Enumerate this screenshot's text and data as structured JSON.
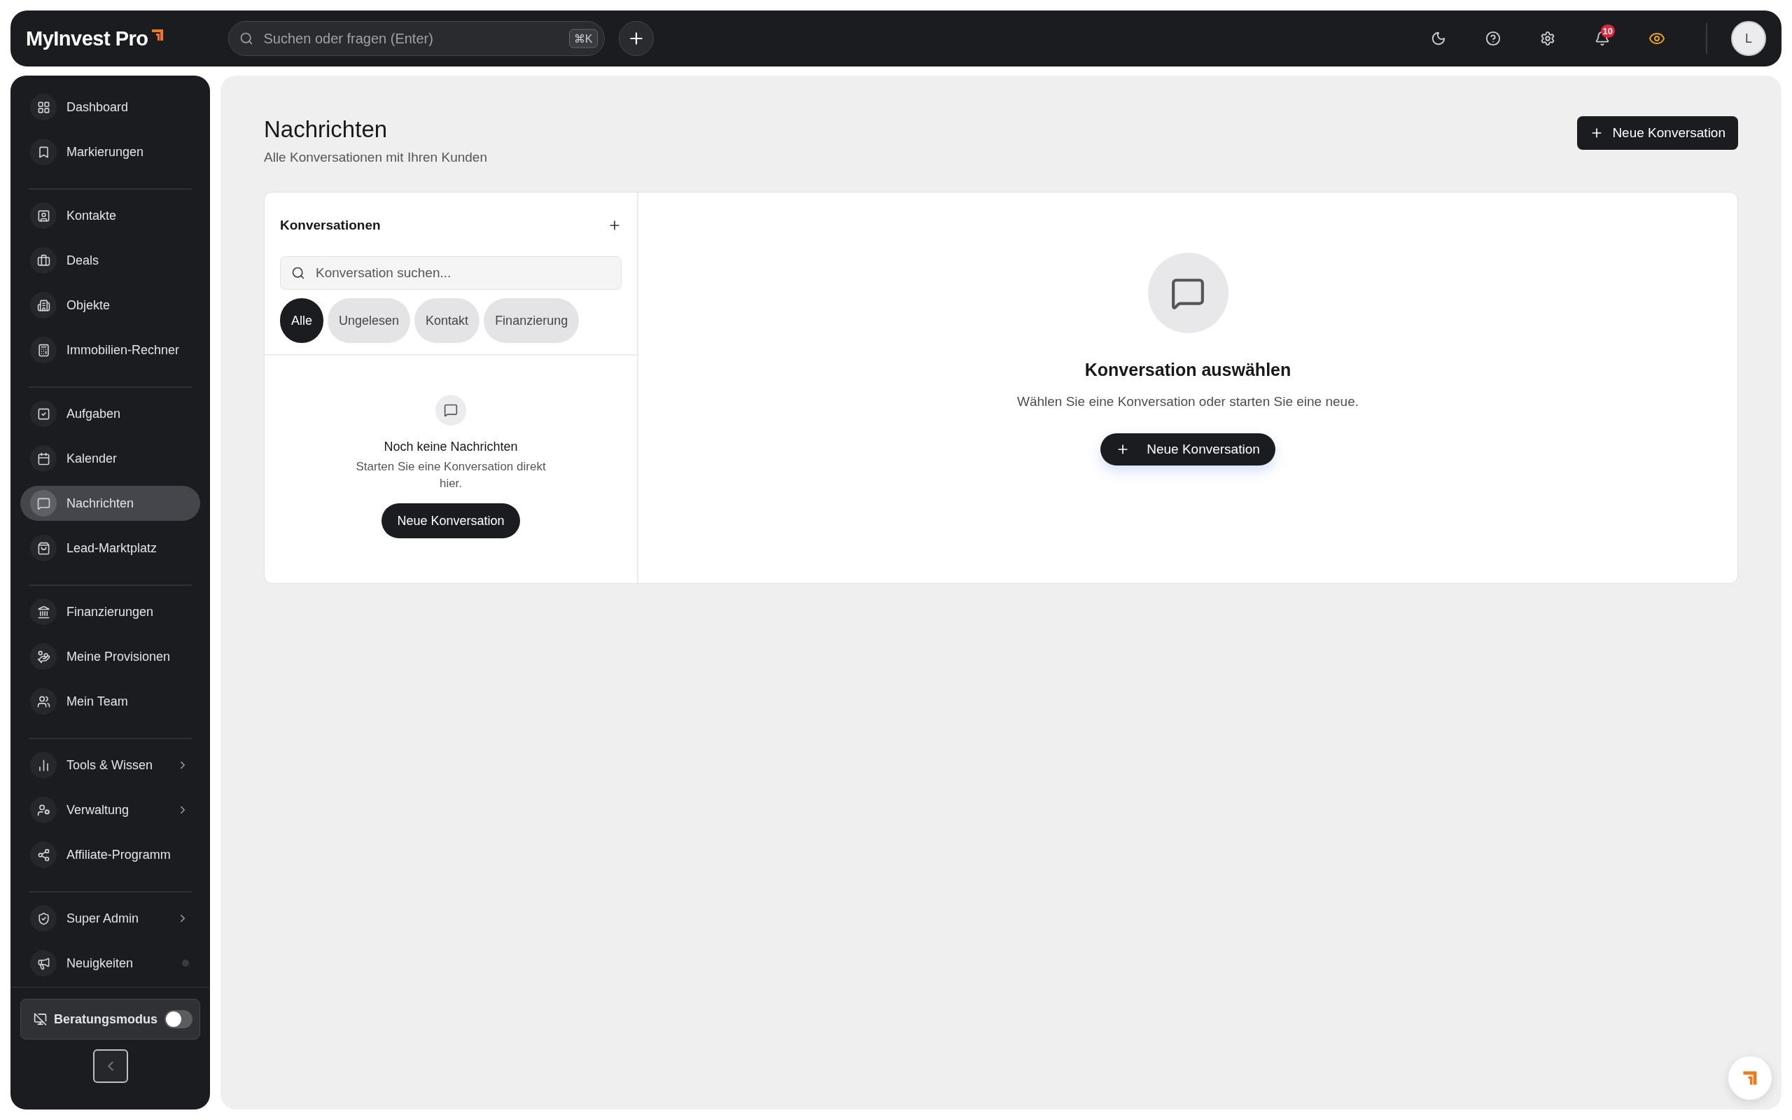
{
  "topbar": {
    "logo": "MyInvest Pro",
    "search": {
      "placeholder": "Suchen oder fragen (Enter)",
      "shortcut": "⌘K"
    },
    "notifications": "10",
    "avatar": "L"
  },
  "sidebar": {
    "groups": [
      [
        {
          "label": "Dashboard",
          "selected": false,
          "kind": "link"
        },
        {
          "label": "Markierungen",
          "selected": false,
          "kind": "link"
        }
      ],
      [
        {
          "label": "Kontakte",
          "selected": false,
          "kind": "link"
        },
        {
          "label": "Deals",
          "selected": false,
          "kind": "link"
        },
        {
          "label": "Objekte",
          "selected": false,
          "kind": "link"
        },
        {
          "label": "Immobilien-Rechner",
          "selected": false,
          "kind": "link"
        }
      ],
      [
        {
          "label": "Aufgaben",
          "selected": false,
          "kind": "link"
        },
        {
          "label": "Kalender",
          "selected": false,
          "kind": "link"
        },
        {
          "label": "Nachrichten",
          "selected": true,
          "kind": "link"
        },
        {
          "label": "Lead-Marktplatz",
          "selected": false,
          "kind": "link"
        }
      ],
      [
        {
          "label": "Finanzierungen",
          "selected": false,
          "kind": "link"
        },
        {
          "label": "Meine Provisionen",
          "selected": false,
          "kind": "link"
        },
        {
          "label": "Mein Team",
          "selected": false,
          "kind": "link"
        }
      ],
      [
        {
          "label": "Tools & Wissen",
          "selected": false,
          "kind": "submenu"
        },
        {
          "label": "Verwaltung",
          "selected": false,
          "kind": "submenu"
        },
        {
          "label": "Affiliate-Programm",
          "selected": false,
          "kind": "link"
        }
      ],
      [
        {
          "label": "Super Admin",
          "selected": false,
          "kind": "submenu"
        },
        {
          "label": "Neuigkeiten",
          "selected": false,
          "kind": "dot"
        }
      ]
    ],
    "mode_toggle": {
      "label": "Beratungsmodus",
      "on": false
    }
  },
  "page": {
    "title": "Nachrichten",
    "subtitle": "Alle Konversationen mit Ihren Kunden",
    "action": "Neue Konversation"
  },
  "conversations": {
    "title": "Konversationen",
    "search_placeholder": "Konversation suchen...",
    "filters": [
      {
        "label": "Alle",
        "selected": true
      },
      {
        "label": "Ungelesen",
        "selected": false
      },
      {
        "label": "Kontakt",
        "selected": false
      },
      {
        "label": "Finanzierung",
        "selected": false
      }
    ],
    "empty": {
      "title": "Noch keine Nachrichten",
      "text": "Starten Sie eine Konversation direkt hier.",
      "button": "Neue Konversation"
    }
  },
  "detail": {
    "title": "Konversation auswählen",
    "text": "Wählen Sie eine Konversation oder starten Sie eine neue.",
    "button": "Neue Konversation"
  }
}
